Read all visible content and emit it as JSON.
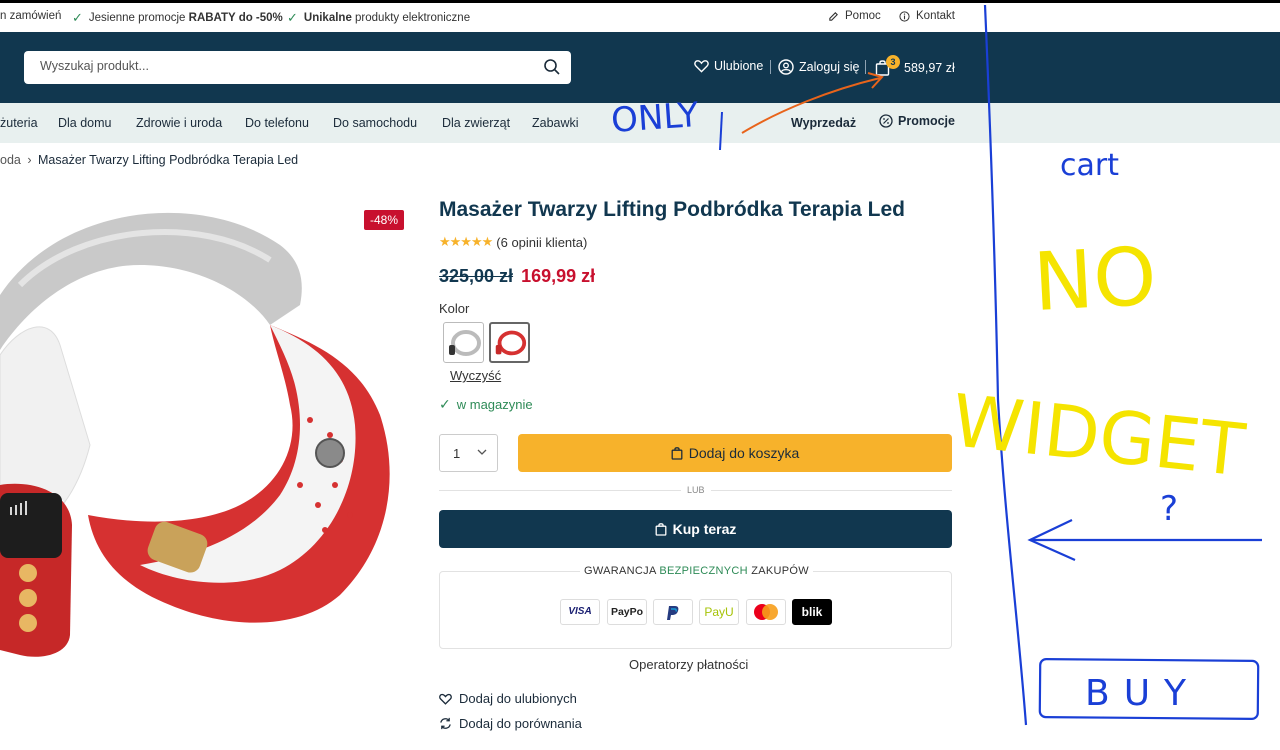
{
  "topbar": {
    "item1": "n zamówień",
    "item2_prefix": "Jesienne promocje ",
    "item2_bold": "RABATY do -50%",
    "item3_bold": "Unikalne",
    "item3_suffix": " produkty elektroniczne",
    "help": "Pomoc",
    "contact": "Kontakt"
  },
  "header": {
    "search_placeholder": "Wyszukaj produkt...",
    "favorites": "Ulubione",
    "login": "Zaloguj się",
    "cart_count": "3",
    "cart_total": "589,97 zł"
  },
  "nav": {
    "items": [
      "żuteria",
      "Dla domu",
      "Zdrowie i uroda",
      "Do telefonu",
      "Do samochodu",
      "Dla zwierząt",
      "Zabawki"
    ],
    "sale": "Wyprzedaż",
    "promo": "Promocje"
  },
  "breadcrumb": {
    "parent": "oda",
    "sep": "›",
    "current": "Masażer Twarzy Lifting Podbródka Terapia Led"
  },
  "product": {
    "discount": "-48%",
    "title": "Masażer Twarzy Lifting Podbródka Terapia Led",
    "rating": 4.5,
    "reviews": "(6 opinii klienta)",
    "old_price": "325,00 zł",
    "new_price": "169,99 zł",
    "color_label": "Kolor",
    "clear": "Wyczyść",
    "stock": "w magazynie",
    "qty": "1",
    "add_to_cart": "Dodaj do koszyka",
    "or": "LUB",
    "buy_now": "Kup teraz",
    "guarantee_pre": "GWARANCJA ",
    "guarantee_acc": "BEZPIECZNYCH",
    "guarantee_post": " ZAKUPÓW",
    "payments": [
      "VISA",
      "PayPo",
      "PayPal",
      "PayU",
      "Mastercard",
      "blik"
    ],
    "operators": "Operatorzy płatności",
    "add_fav": "Dodaj do ulubionych",
    "add_compare": "Dodaj do porównania"
  },
  "annotations": {
    "only": "ONLY",
    "cart": "cart",
    "no": "NO",
    "widget": "WIDGET",
    "question": "?",
    "buy": "BUY"
  },
  "colors": {
    "navy": "#11374f",
    "yellow": "#f7b22b",
    "red": "#c8102e",
    "green": "#2e8b57",
    "annot_blue": "#1a3fd6",
    "annot_yellow": "#f5e400",
    "annot_orange": "#e8641b"
  }
}
